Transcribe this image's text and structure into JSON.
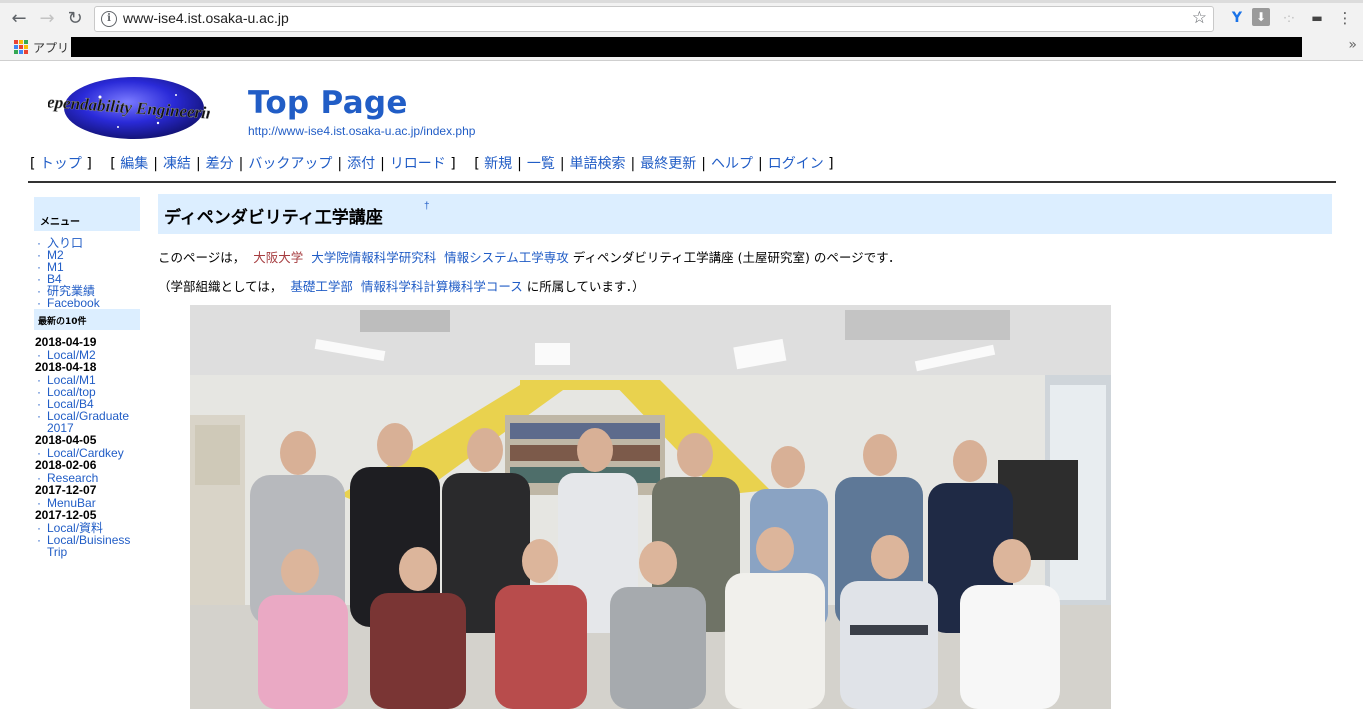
{
  "browser": {
    "url": "www-ise4.ist.osaka-u.ac.jp",
    "bookmarks": {
      "apps_label": "アプリ"
    },
    "colors": {
      "toolbar": "#f2f2f2"
    }
  },
  "site": {
    "logo_text": "Dependability Engineering",
    "title": "Top Page",
    "url": "http://www-ise4.ist.osaka-u.ac.jp/index.php"
  },
  "navbar": {
    "group1": [
      "トップ"
    ],
    "group2": [
      "編集",
      "凍結",
      "差分",
      "バックアップ",
      "添付",
      "リロード"
    ],
    "group3": [
      "新規",
      "一覧",
      "単語検索",
      "最終更新",
      "ヘルプ",
      "ログイン"
    ]
  },
  "menu": {
    "title": "メニュー",
    "items": [
      "入り口",
      "M2",
      "M1",
      "B4",
      "研究業績",
      "Facebook"
    ],
    "recent_title": "最新の10件",
    "recent": [
      {
        "date": "2018-04-19",
        "pages": [
          "Local/M2"
        ]
      },
      {
        "date": "2018-04-18",
        "pages": [
          "Local/M1",
          "Local/top",
          "Local/B4",
          "Local/Graduate 2017"
        ]
      },
      {
        "date": "2018-04-05",
        "pages": [
          "Local/Cardkey"
        ]
      },
      {
        "date": "2018-02-06",
        "pages": [
          "Research"
        ]
      },
      {
        "date": "2017-12-07",
        "pages": [
          "MenuBar"
        ]
      },
      {
        "date": "2017-12-05",
        "pages": [
          "Local/資料",
          "Local/Buisiness Trip"
        ]
      }
    ]
  },
  "content": {
    "heading": "ディペンダビリティ工学講座",
    "anchor": "†",
    "para1": {
      "prefix": "このページは，",
      "link1": "大阪大学",
      "link2": "大学院情報科学研究科",
      "link3": "情報システム工学専攻",
      "suffix": " ディペンダビリティ工学講座 (土屋研究室) のページです．"
    },
    "para2": {
      "prefix": "（学部組織としては，",
      "link1": "基礎工学部",
      "link2": "情報科学科計算機科学コース",
      "suffix": " に所属しています．）"
    }
  }
}
